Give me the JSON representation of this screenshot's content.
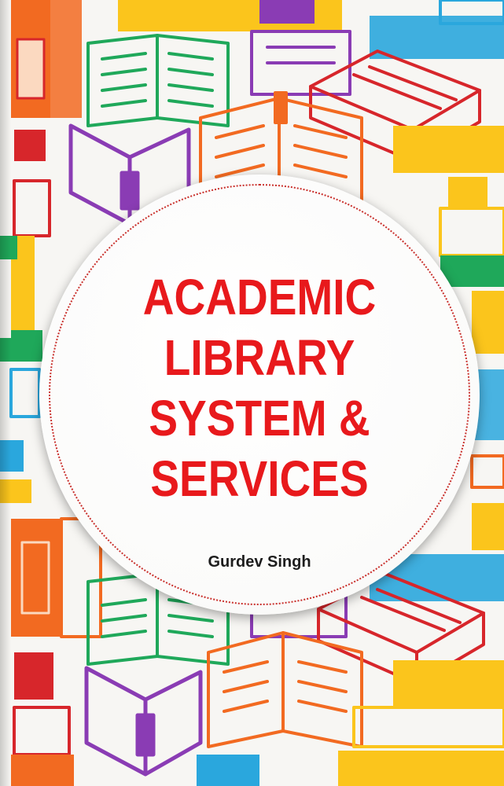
{
  "book": {
    "title_lines": [
      "ACADEMIC",
      "LIBRARY",
      "SYSTEM &",
      "SERVICES"
    ],
    "author": "Gurdev Singh"
  },
  "colors": {
    "title_red": "#e8191c",
    "orange": "#f26a21",
    "yellow": "#fbc51c",
    "green": "#1fa85a",
    "purple": "#8a3cb4",
    "blue": "#2aa7dd",
    "red": "#d7262b",
    "background": "#f7f6f3"
  },
  "icons": [
    "open-book-icon",
    "closed-book-icon",
    "book-stack-icon"
  ]
}
